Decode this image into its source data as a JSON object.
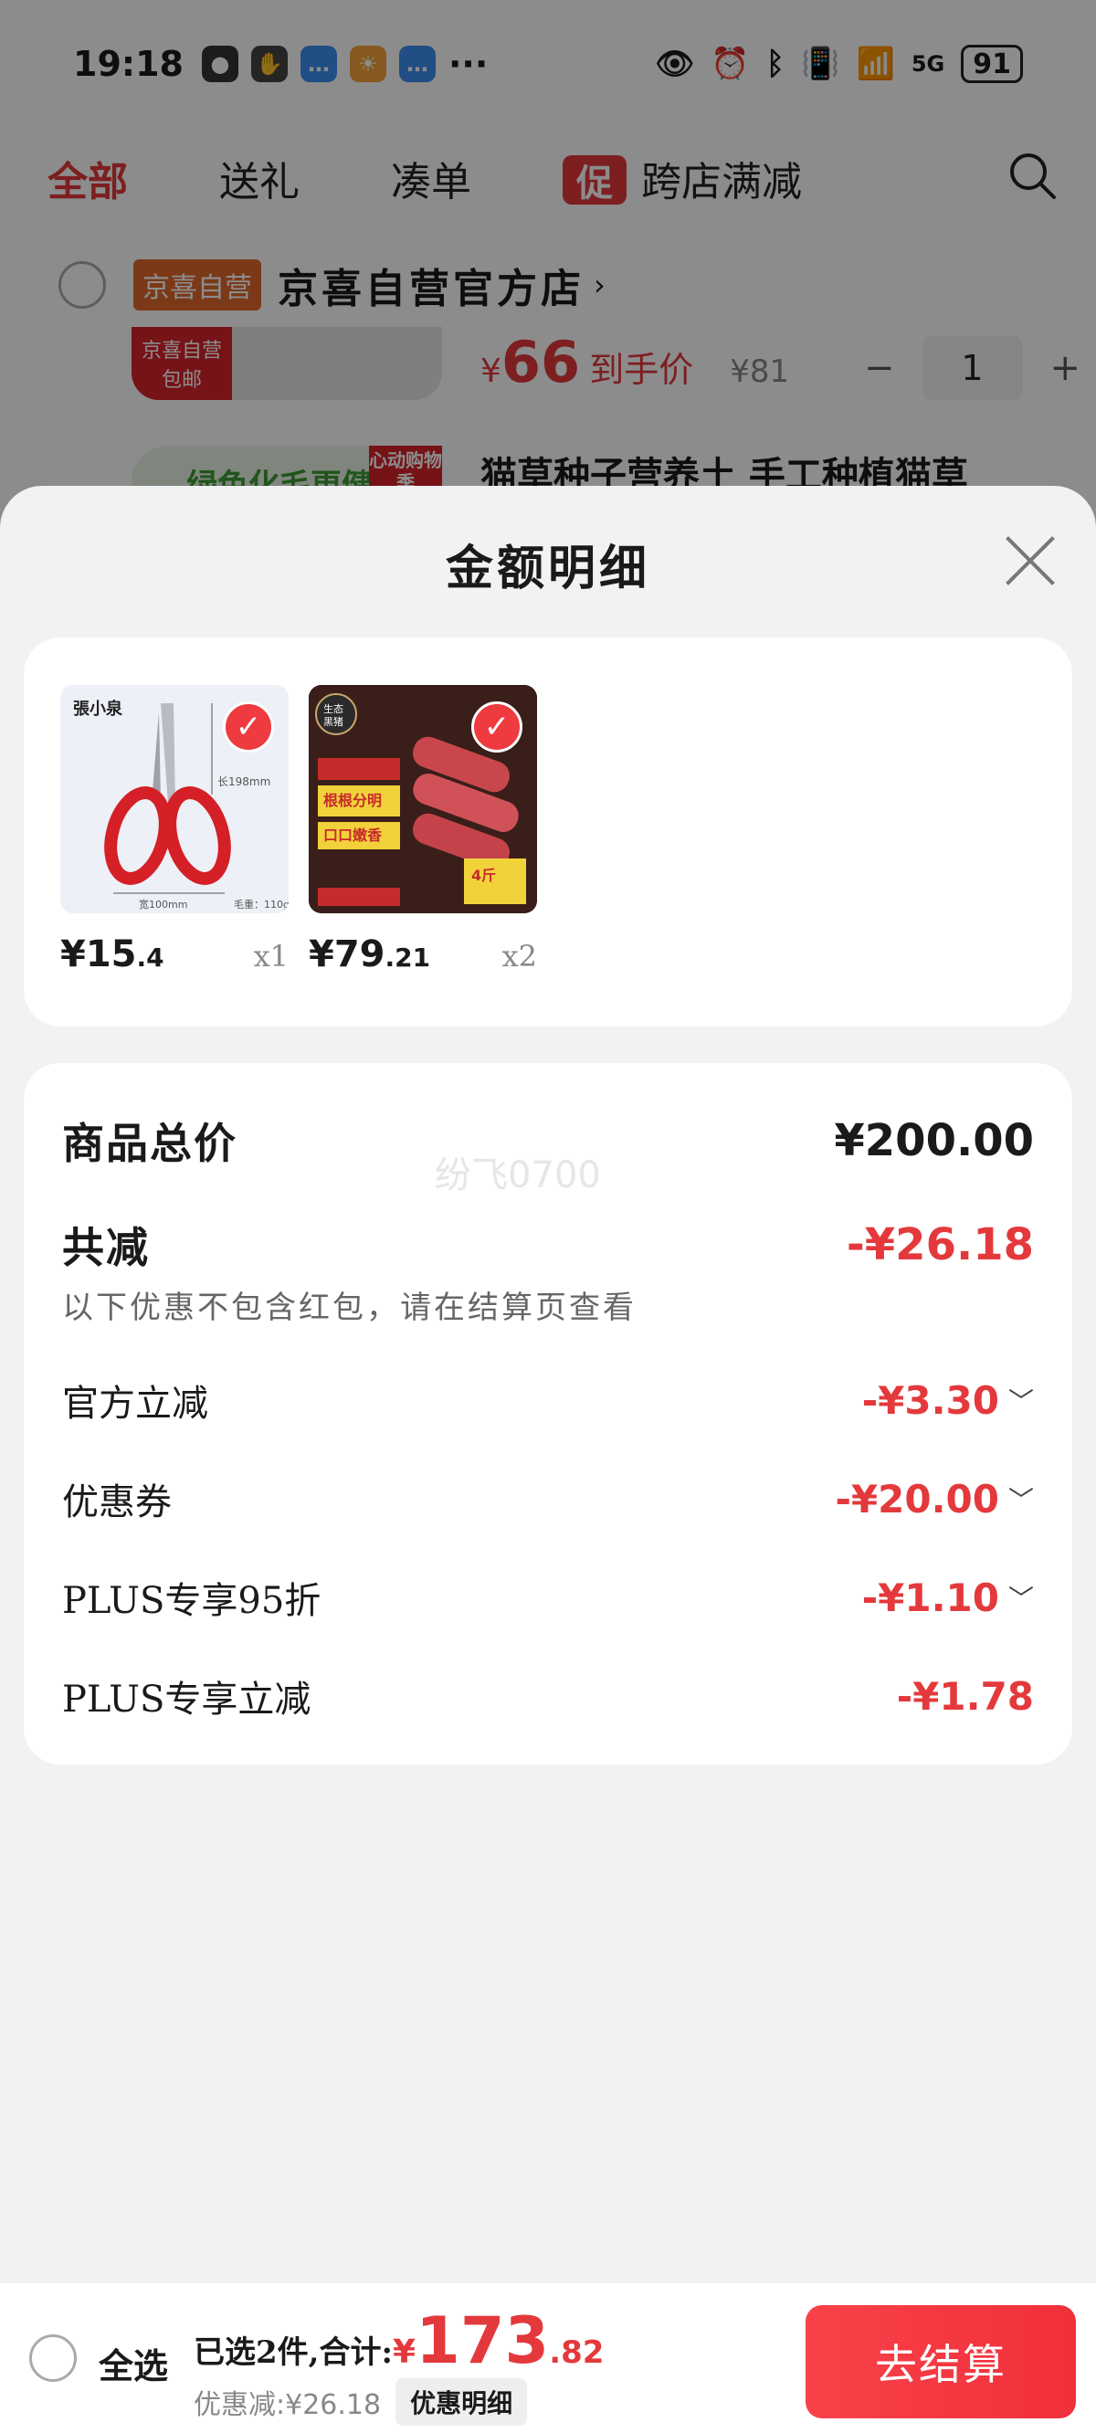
{
  "status_bar": {
    "time": "19:18",
    "battery": "91",
    "network": "5G"
  },
  "tabs": [
    {
      "label": "全部",
      "active": true
    },
    {
      "label": "送礼"
    },
    {
      "label": "凑单"
    },
    {
      "label": "跨店满减",
      "badge": "促"
    }
  ],
  "store": {
    "tag": "京喜自营",
    "name": "京喜自营官方店",
    "item1": {
      "thumb_tag": "京喜自营 包邮",
      "price_symbol": "¥",
      "price": "66",
      "price_label": "到手价",
      "original_price": "¥81",
      "quantity": "1"
    },
    "item2": {
      "promo": "绿色化毛更健康",
      "promo_tag": "心动购物季",
      "title": "猫草种子营养土 手工种植猫草"
    }
  },
  "sheet": {
    "title": "金额明细",
    "products": [
      {
        "price_int": "¥15",
        "price_dec": ".4",
        "qty": "x1",
        "image": "scissors"
      },
      {
        "price_int": "¥79",
        "price_dec": ".21",
        "qty": "x2",
        "image": "pork-ribs"
      }
    ],
    "total_label": "商品总价",
    "total_value": "¥200.00",
    "discount_label": "共减",
    "discount_value": "-¥26.18",
    "note": "以下优惠不包含红包，请在结算页查看",
    "watermark": "纷飞0700",
    "items": [
      {
        "label": "官方立减",
        "value": "-¥3.30",
        "expandable": true
      },
      {
        "label": "优惠券",
        "value": "-¥20.00",
        "expandable": true
      },
      {
        "label": "PLUS专享95折",
        "value": "-¥1.10",
        "expandable": true
      },
      {
        "label": "PLUS专享立减",
        "value": "-¥1.78",
        "expandable": false
      }
    ]
  },
  "bottom_bar": {
    "select_all": "全选",
    "selected_text": "已选2件,合计:",
    "total_symbol": "¥",
    "total_int": "173",
    "total_dec": ".82",
    "discount_text": "优惠减:¥26.18",
    "detail_button": "优惠明细",
    "checkout_button": "去结算"
  },
  "colors": {
    "accent_red": "#e4393c",
    "store_tag": "#e0682a",
    "sheet_bg": "#f2f2f4"
  }
}
